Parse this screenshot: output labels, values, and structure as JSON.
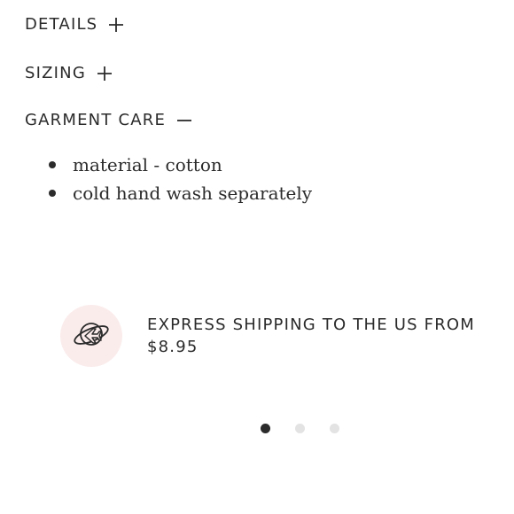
{
  "accordion": {
    "sections": [
      {
        "title": "DETAILS",
        "toggle": "+",
        "expanded": false
      },
      {
        "title": "SIZING",
        "toggle": "+",
        "expanded": false
      },
      {
        "title": "GARMENT CARE",
        "toggle": "—",
        "expanded": true
      }
    ],
    "garment_care_items": [
      "material - cotton",
      "cold hand wash separately"
    ]
  },
  "shipping": {
    "icon": "plane-globe-icon",
    "line1": "EXPRESS SHIPPING TO THE US FROM",
    "line2": "$8.95"
  },
  "carousel": {
    "dot_count": 3,
    "active_index": 0
  },
  "colors": {
    "text": "#2b2b2b",
    "icon_bg": "#fbecec",
    "dot_inactive": "#e3e3e3",
    "dot_active": "#2b2b2b"
  }
}
